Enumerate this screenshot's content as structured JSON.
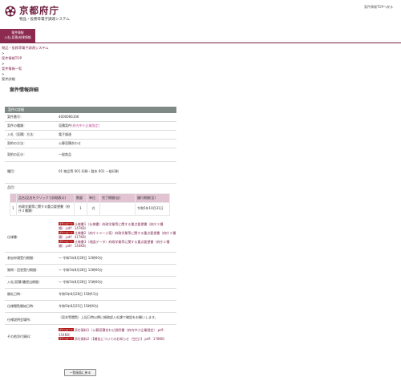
{
  "header": {
    "logo_text": "京都府庁",
    "system_name": "物品・役務等電子調達システム",
    "top_link": "案件情報TOPへ戻る"
  },
  "nav": {
    "tab_line1": "案件情報",
    "tab_line2": "入札(見積)結果情報"
  },
  "breadcrumb": {
    "items": [
      "物品・役務等電子調達システム",
      ">",
      "案件情報TOP",
      ">",
      "案件情報一覧",
      ">"
    ],
    "current": "案件詳細"
  },
  "page_title": "案件情報詳細",
  "panel_title": "案件の詳細",
  "fields": {
    "case_no": {
      "label": "案件番号：",
      "value": "4000066106"
    },
    "case_type": {
      "label": "案件の種類：",
      "value": "見積案件",
      "note": "(府内中小企業限定)"
    },
    "method": {
      "label": "入札（見積）方法：",
      "value": "電子調達"
    },
    "contract_method": {
      "label": "契約の方法：",
      "value": "公募見積合わせ"
    },
    "category": {
      "label": "契約の区分：",
      "value": "一般商品"
    },
    "item_type": {
      "label": "種目：",
      "value": "01 物品等 001 印刷・製本 001 一般印刷"
    },
    "items_label": {
      "label": "品目："
    },
    "spec": {
      "label": "仕様書："
    },
    "reg_deadline": {
      "label": "参加申請受付期間：",
      "value": "～ 令和5年8月28日 12時00分"
    },
    "question_period": {
      "label": "質問・回答受付期間：",
      "value": "～ 令和5年8月28日 12時00分"
    },
    "bid_period": {
      "label": "入札(見積)書提出期間：",
      "value": "～ 令和5年8月28日 15時00分"
    },
    "open_date": {
      "label": "開札日時：",
      "value": "令和5年8月28日 15時15分"
    },
    "announce_date": {
      "label": "仕様閲覧開始日時：",
      "value": "令和5年8月25日 15時00分"
    },
    "venue": {
      "label": "仕様説明会場所：",
      "value": "（見本等閲覧）上記日時以降に総務部入札課で確認をお願いします。"
    },
    "other": {
      "label": "その他添付資料："
    }
  },
  "items_table": {
    "headers": [
      "品名(品名をクリックで詳細表示)",
      "数量",
      "単位",
      "完了期間(自)",
      "履行期間(至)"
    ],
    "rows": [
      {
        "no": "1",
        "name": "府政学業等に関する重点要望書（府庁２種類）",
        "qty": "1",
        "unit": "式",
        "from": "",
        "to": "令和5年10月31日"
      }
    ]
  },
  "download_tag": "ダウンロード",
  "spec_files": [
    {
      "text": "仕様書1（仕様書）府政学業等に関する重点要望書（府庁２種類）.pdf：147KB）"
    },
    {
      "text": "仕様書2（府庁イメージ案）府政学業等に関する重点要望書（府庁２種類）.pdf：417KB）"
    },
    {
      "text": "仕様書3（地図データ）府政学業等に関する重点要望書（府庁２種類）.pdf：144KB）"
    }
  ],
  "other_files": [
    {
      "text": "添付資料1（公募見積合わせ説明書（府内中小企業限定）.pdf：154KB）"
    },
    {
      "text": "添付資料2（【補佐についてのお知らせ（空白）】.pdf：178KB）"
    }
  ],
  "back_button": "一覧画面に戻る",
  "colors": {
    "brand": "#8c2a50",
    "panel_head": "#7f8a87",
    "tag": "#b01818"
  }
}
